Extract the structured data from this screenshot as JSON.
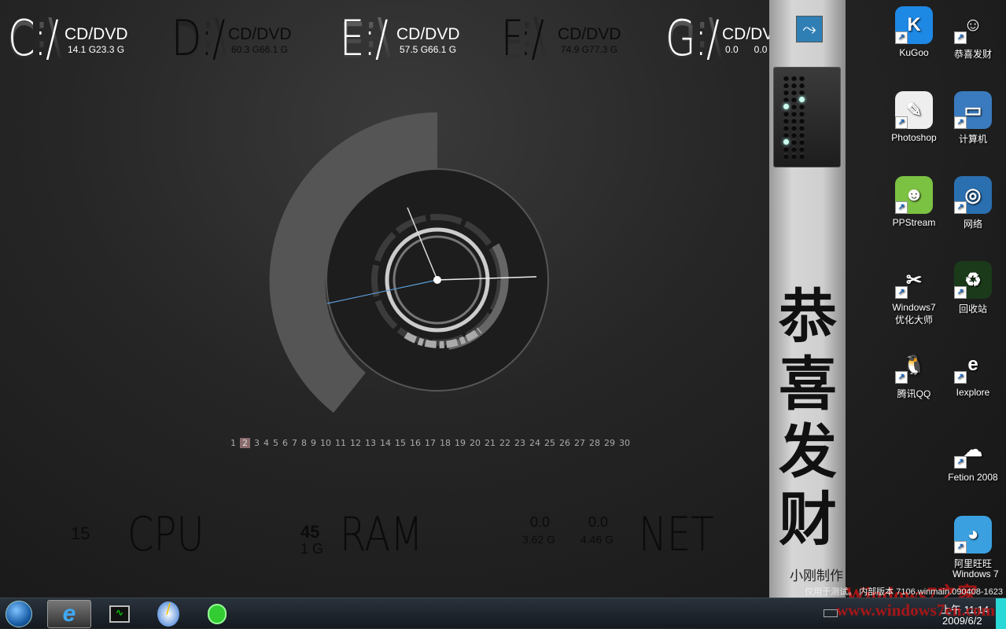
{
  "drives": [
    {
      "letter": "C:/",
      "type": "CD/DVD",
      "size": "14.1 G23.3 G",
      "tone": "light"
    },
    {
      "letter": "D:/",
      "type": "CD/DVD",
      "size": "60.3 G66.1 G",
      "tone": "dark"
    },
    {
      "letter": "E:/",
      "type": "CD/DVD",
      "size": "57.5 G66.1 G",
      "tone": "light"
    },
    {
      "letter": "F:/",
      "type": "CD/DVD",
      "size": "74.9 G77.3 G",
      "tone": "dark"
    },
    {
      "letter": "G:/",
      "type": "CD/DVD",
      "size": "0.0      0.0",
      "tone": "light"
    }
  ],
  "pages": [
    "1",
    "2",
    "3",
    "4",
    "5",
    "6",
    "7",
    "8",
    "9",
    "10",
    "11",
    "12",
    "13",
    "14",
    "15",
    "16",
    "17",
    "18",
    "19",
    "20",
    "21",
    "22",
    "23",
    "24",
    "25",
    "26",
    "27",
    "28",
    "29",
    "30"
  ],
  "current_page": "2",
  "meters": {
    "cpu_value": "15",
    "cpu_label": "CPU",
    "ram_value": "45",
    "ram_total": "1 G",
    "ram_label": "RAM",
    "net_up": "0.0",
    "net_down": "0.0",
    "net_up_total": "3.62 G",
    "net_down_total": "4.46 G",
    "net_label": "NET"
  },
  "panel": {
    "title_chars": [
      "恭",
      "喜",
      "发",
      "财"
    ],
    "maker": "小刚制作"
  },
  "desktop_icons": [
    {
      "label": "KuGoo",
      "icon": "kugoo-icon",
      "color": "#1e88e5",
      "glyph": "K"
    },
    {
      "label": "恭喜发财",
      "icon": "mascot-icon",
      "color": "transparent",
      "glyph": "☺"
    },
    {
      "label": "Photoshop",
      "icon": "photoshop-icon",
      "color": "#eee",
      "glyph": "✎"
    },
    {
      "label": "计算机",
      "icon": "computer-icon",
      "color": "#3a7bbf",
      "glyph": "▭"
    },
    {
      "label": "PPStream",
      "icon": "ppstream-icon",
      "color": "#7cc242",
      "glyph": "☻"
    },
    {
      "label": "网络",
      "icon": "network-icon",
      "color": "#2a6fb0",
      "glyph": "◎"
    },
    {
      "label": "Windows7\n优化大师",
      "icon": "swiss-knife-icon",
      "color": "transparent",
      "glyph": "✂"
    },
    {
      "label": "回收站",
      "icon": "recycle-bin-icon",
      "color": "#1a3a1a",
      "glyph": "♻"
    },
    {
      "label": "腾讯QQ",
      "icon": "qq-icon",
      "color": "transparent",
      "glyph": "🐧"
    },
    {
      "label": "Iexplore",
      "icon": "ie-icon",
      "color": "transparent",
      "glyph": "e"
    },
    {
      "label": "Fetion 2008",
      "icon": "fetion-icon",
      "color": "transparent",
      "glyph": "☁"
    },
    {
      "label": "阿里旺旺",
      "icon": "aliwangwang-icon",
      "color": "#3aa0e0",
      "glyph": "◕"
    }
  ],
  "watermark": {
    "os": "Windows 7",
    "build": "仅用于测试。 内部版本 7106.winmain.090408-1623",
    "logo": "Windows7之家",
    "url": "www.windows7en.com"
  },
  "tray": {
    "time": "上午 11:14",
    "date": "2009/6/2"
  },
  "taskbar": [
    "start-orb-icon",
    "ie-icon",
    "task-manager-icon",
    "search-pen-icon",
    "network-monitor-icon"
  ]
}
